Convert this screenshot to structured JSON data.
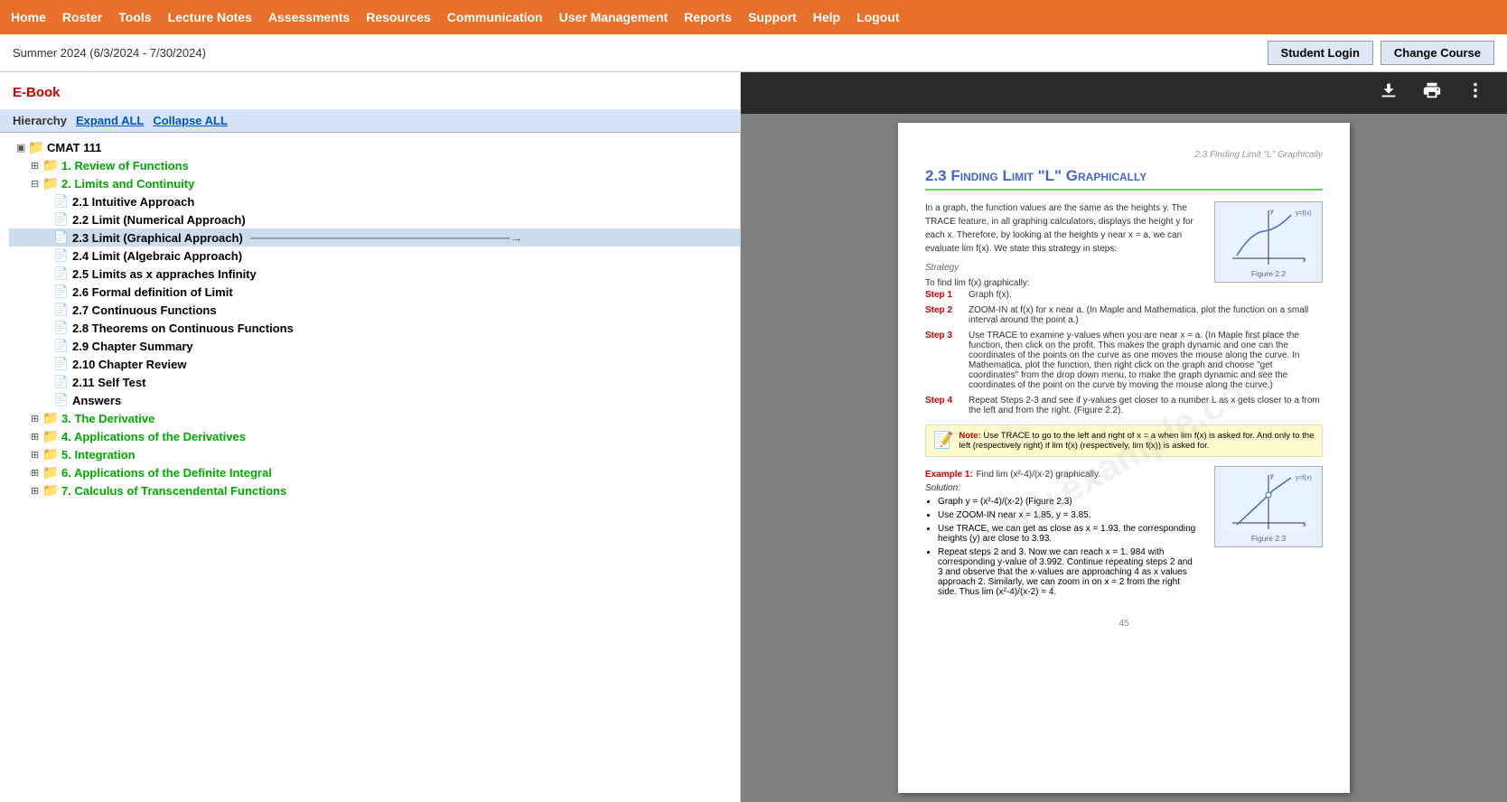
{
  "nav": {
    "items": [
      "Home",
      "Roster",
      "Tools",
      "Lecture Notes",
      "Assessments",
      "Resources",
      "Communication",
      "User Management",
      "Reports",
      "Support",
      "Help",
      "Logout"
    ]
  },
  "subheader": {
    "date": "Summer 2024 (6/3/2024 - 7/30/2024)",
    "student_login": "Student Login",
    "change_course": "Change Course"
  },
  "ebook": {
    "title": "E-Book",
    "hierarchy_label": "Hierarchy",
    "expand_all": "Expand ALL",
    "collapse_all": "Collapse ALL"
  },
  "tree": {
    "root_label": "CMAT 111",
    "chapters": [
      {
        "id": "ch1",
        "label": "1. Review of Functions",
        "expanded": false,
        "items": []
      },
      {
        "id": "ch2",
        "label": "2. Limits and Continuity",
        "expanded": true,
        "items": [
          {
            "id": "2.1",
            "label": "2.1 Intuitive Approach",
            "active": false
          },
          {
            "id": "2.2",
            "label": "2.2 Limit (Numerical Approach)",
            "active": false
          },
          {
            "id": "2.3",
            "label": "2.3 Limit (Graphical Approach)",
            "active": true
          },
          {
            "id": "2.4",
            "label": "2.4 Limit (Algebraic Approach)",
            "active": false
          },
          {
            "id": "2.5",
            "label": "2.5 Limits as x appraches Infinity",
            "active": false
          },
          {
            "id": "2.6",
            "label": "2.6 Formal definition of Limit",
            "active": false
          },
          {
            "id": "2.7",
            "label": "2.7 Continuous Functions",
            "active": false
          },
          {
            "id": "2.8",
            "label": "2.8 Theorems on Continuous Functions",
            "active": false
          },
          {
            "id": "2.9",
            "label": "2.9 Chapter Summary",
            "active": false
          },
          {
            "id": "2.10",
            "label": "2.10 Chapter Review",
            "active": false
          },
          {
            "id": "2.11",
            "label": "2.11 Self Test",
            "active": false
          },
          {
            "id": "ans",
            "label": "Answers",
            "active": false
          }
        ]
      },
      {
        "id": "ch3",
        "label": "3. The Derivative",
        "expanded": false,
        "items": []
      },
      {
        "id": "ch4",
        "label": "4. Applications of the Derivatives",
        "expanded": false,
        "items": []
      },
      {
        "id": "ch5",
        "label": "5. Integration",
        "expanded": false,
        "items": []
      },
      {
        "id": "ch6",
        "label": "6. Applications of the Definite Integral",
        "expanded": false,
        "items": []
      },
      {
        "id": "ch7",
        "label": "7. Calculus of Transcendental Functions",
        "expanded": false,
        "items": []
      }
    ]
  },
  "viewer": {
    "toolbar_icons": [
      "download",
      "print",
      "more"
    ],
    "page_header": "2.3  Finding Limit \"L\" Graphically",
    "chapter_title": "2.3  Finding Limit \"L\" Graphically",
    "intro_text": "In a graph, the function values are the same as the heights y. The TRACE feature, in all graphing calculators, displays the height y for each x. Therefore, by looking at the heights y near x = a, we can evaluate lim f(x). We state this strategy in steps:",
    "strategy_label": "Strategy",
    "strategy_text": "To find lim f(x) graphically:",
    "steps": [
      {
        "label": "Step 1",
        "text": "Graph f(x)."
      },
      {
        "label": "Step 2",
        "text": "ZOOM-IN at f(x) for x near a. (In Maple and Mathematica, plot the function on a small interval around the point a.)"
      },
      {
        "label": "Step 3",
        "text": "Use TRACE to examine y-values when you are near x = a. (In Maple first place the function, then click on the profit. This makes the graph dynamic and one can the coordinates of the points on the curve as one moves the mouse along the curve. In Mathematica, plot the function, then right click on the graph and choose \"get coordinates\" from the drop down menu, to make the graph dynamic and see the coordinates of the point on the curve by moving the mouse along the curve.)"
      },
      {
        "label": "Step 4",
        "text": "Repeat Steps 2-3 and see if y-values get closer to a number L as x gets closer to a from the left and from the right. (Figure 2.2)."
      }
    ],
    "note_label": "Note:",
    "note_text": "Use TRACE to go to the left and right of x = a when  lim  f(x) is asked for. And only to the left (respectively right) if lim  f(x) (respectively,  lim  f(x)) is asked for.",
    "figure1_caption": "Figure 2.2",
    "example_label": "Example 1:",
    "example_text": "Find  lim (x²-4)/(x-2)  graphically.",
    "solution_label": "Solution:",
    "solution_steps": [
      "Graph y = (x²-4)/(x-2)  (Figure 2.3)",
      "Use ZOOM-IN near x = 1.85, y = 3.85.",
      "Use TRACE, we can get as close as x = 1.93, the corresponding heights (y) are close to 3.93.",
      "Repeat steps 2 and 3. Now we can reach x = 1. 984 with corresponding y-value of 3.992. Continue repeating steps 2 and 3 and observe that the x-values are approaching 4 as x values approach 2. Similarly, we can zoom in on x = 2 from the right side. Thus  lim (x²-4)/(x-2) = 4."
    ],
    "figure2_caption": "Figure 2.3",
    "page_number": "45",
    "watermark": "www.example.com"
  }
}
